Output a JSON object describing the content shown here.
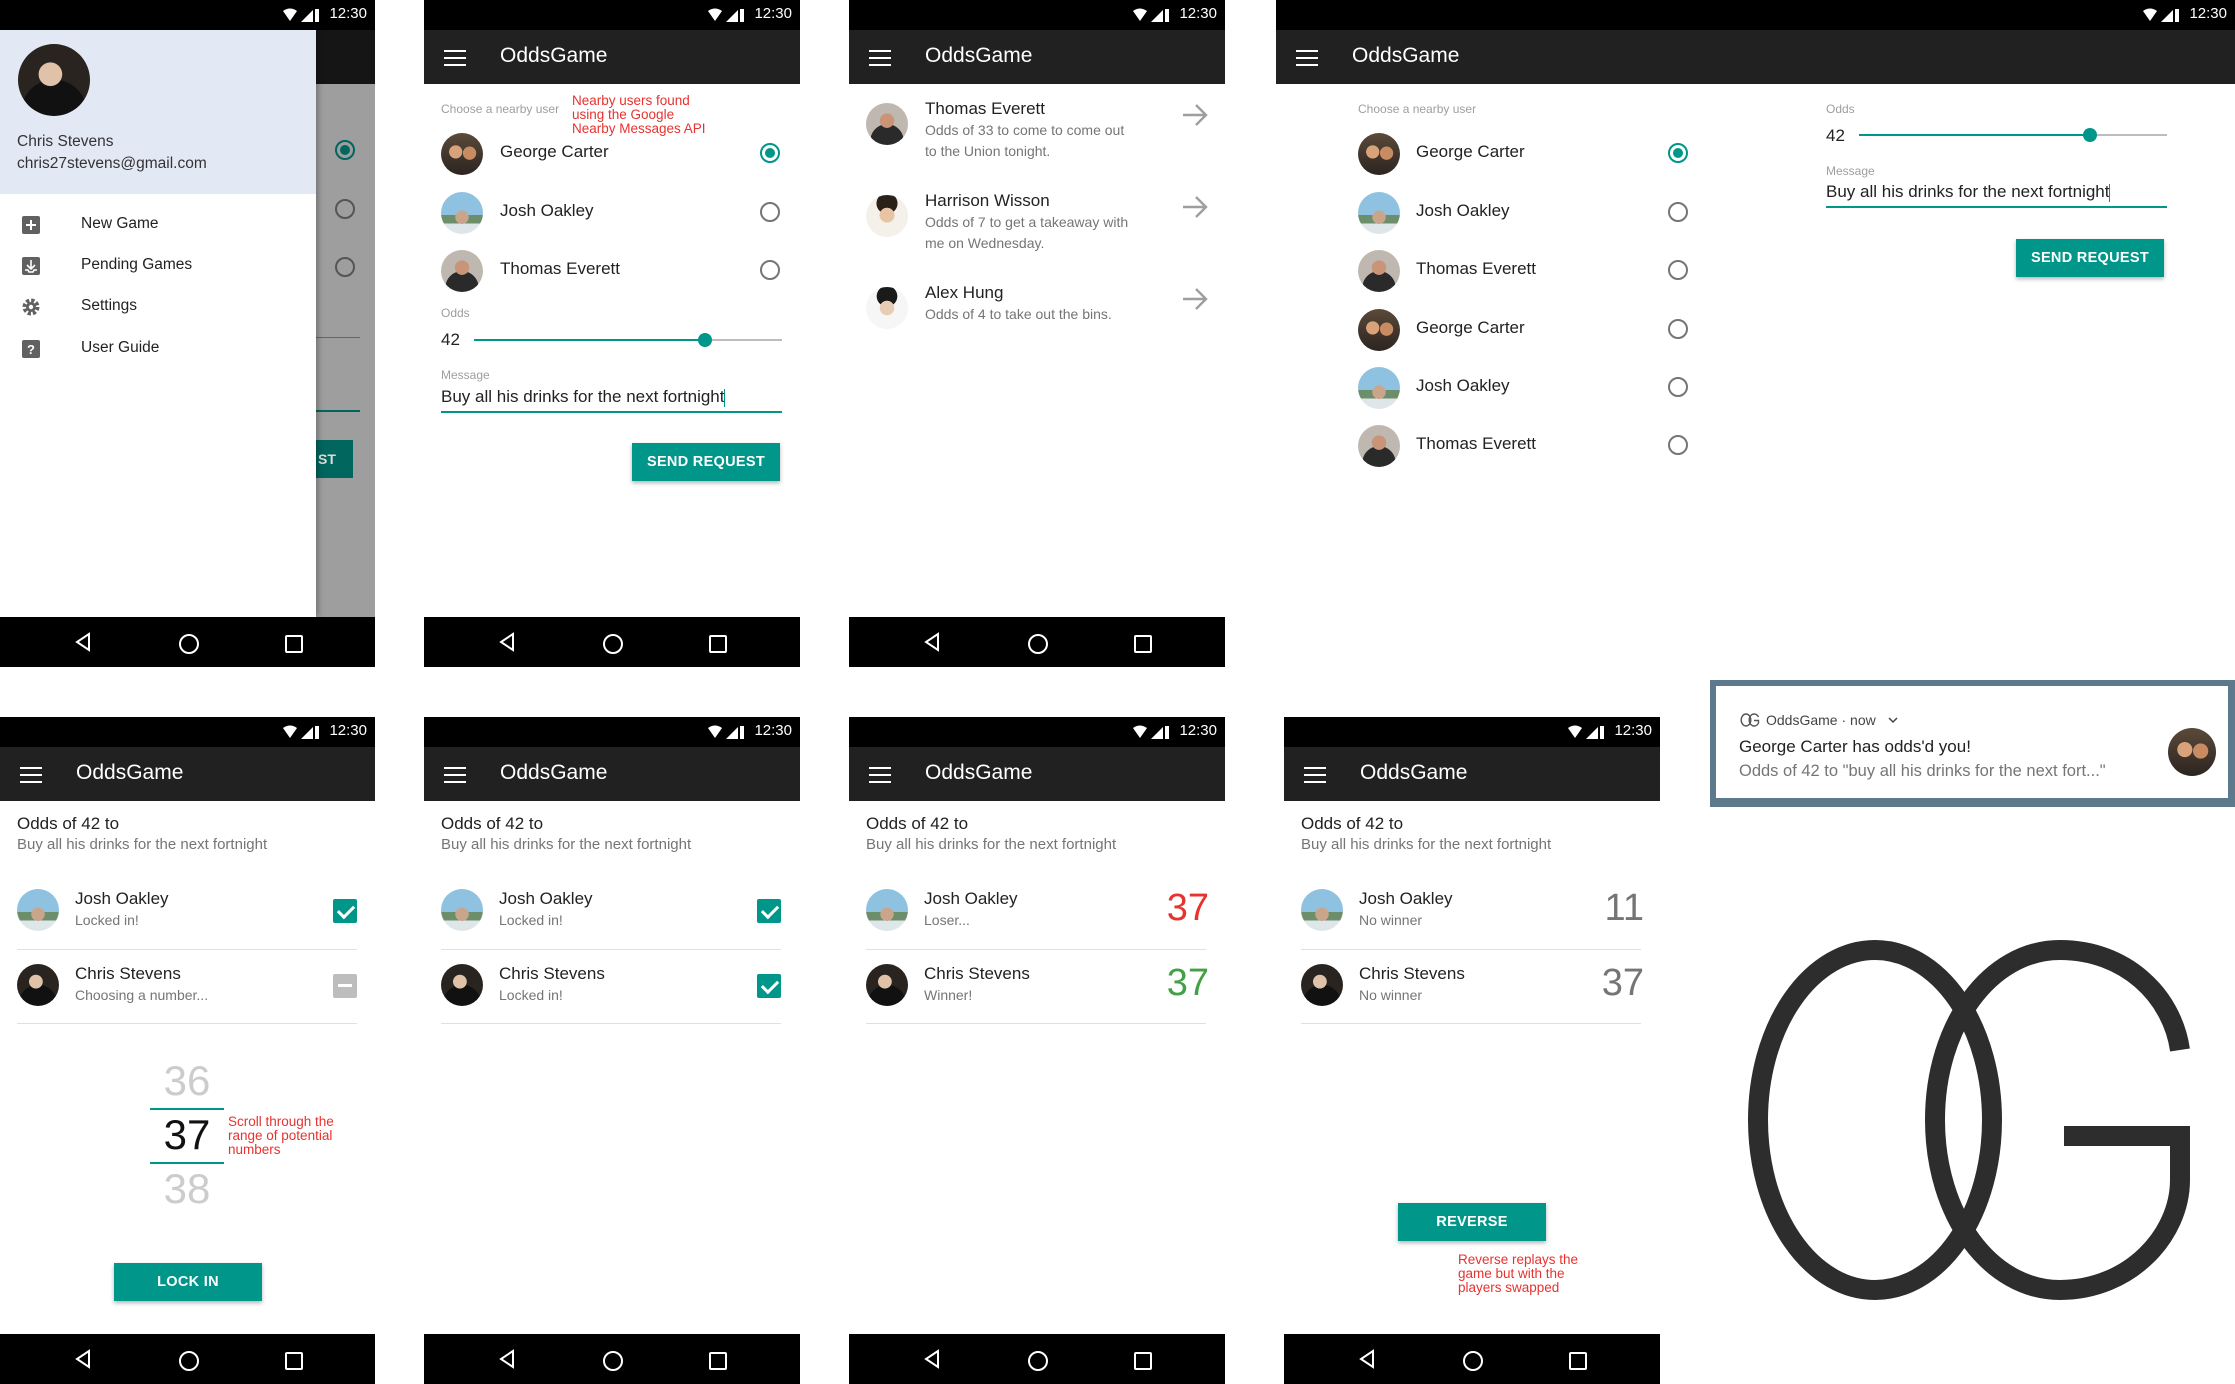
{
  "status": {
    "time": "12:30"
  },
  "app_title": "OddsGame",
  "drawer": {
    "user_name": "Chris Stevens",
    "user_email": "chris27stevens@gmail.com",
    "items": [
      {
        "label": "New Game",
        "icon": "add-box-icon"
      },
      {
        "label": "Pending Games",
        "icon": "inbox-icon"
      },
      {
        "label": "Settings",
        "icon": "gear-icon"
      },
      {
        "label": "User Guide",
        "icon": "help-icon"
      }
    ],
    "partial_button": "ST"
  },
  "new_game": {
    "choose_label": "Choose a nearby user",
    "annotation": [
      "Nearby users found",
      "using the Google",
      "Nearby Messages API"
    ],
    "users": [
      "George Carter",
      "Josh Oakley",
      "Thomas Everett"
    ],
    "tablet_users": [
      "George Carter",
      "Josh Oakley",
      "Thomas Everett",
      "George Carter",
      "Josh Oakley",
      "Thomas Everett"
    ],
    "selected_index": 0,
    "odds_label": "Odds",
    "odds_value": "42",
    "odds_fraction": 0.75,
    "message_label": "Message",
    "message_value": "Buy all his drinks for the next fortnight",
    "send_button": "SEND REQUEST"
  },
  "pending": {
    "items": [
      {
        "name": "Thomas Everett",
        "line1": "Odds of 33 to come to come out",
        "line2": "to the Union tonight.",
        "avatar": "av-te"
      },
      {
        "name": "Harrison Wisson",
        "line1": "Odds of 7 to get a takeaway with",
        "line2": "me on Wednesday.",
        "avatar": "av-hw"
      },
      {
        "name": "Alex Hung",
        "line1": "Odds of 4 to take out the bins.",
        "line2": "",
        "avatar": "av-ah"
      }
    ]
  },
  "game": {
    "title": "Odds of 42 to",
    "subtitle": "Buy all his drinks for the next fortnight",
    "player1": "Josh Oakley",
    "player2": "Chris Stevens",
    "s1": {
      "p1_status": "Locked in!",
      "p2_status": "Choosing a number..."
    },
    "s2": {
      "p1_status": "Locked in!",
      "p2_status": "Locked in!"
    },
    "s3": {
      "p1_status": "Loser...",
      "p2_status": "Winner!",
      "p1_num": "37",
      "p2_num": "37"
    },
    "s4": {
      "p1_status": "No winner",
      "p2_status": "No winner",
      "p1_num": "11",
      "p2_num": "37"
    },
    "picker": [
      "36",
      "37",
      "38"
    ],
    "picker_annotation": [
      "Scroll through the",
      "range of potential",
      "numbers"
    ],
    "lock_button": "LOCK IN",
    "reverse_button": "REVERSE",
    "reverse_annotation": [
      "Reverse replays the",
      "game but with the",
      "players swapped"
    ]
  },
  "notification": {
    "app": "OddsGame",
    "when": "now",
    "title": "George Carter has odds'd you!",
    "body": "Odds of 42 to \"buy all his drinks for the next fort...\""
  },
  "colors": {
    "accent": "#00968a",
    "appbar": "#212121",
    "red": "#e8322f",
    "green": "#43a047"
  }
}
